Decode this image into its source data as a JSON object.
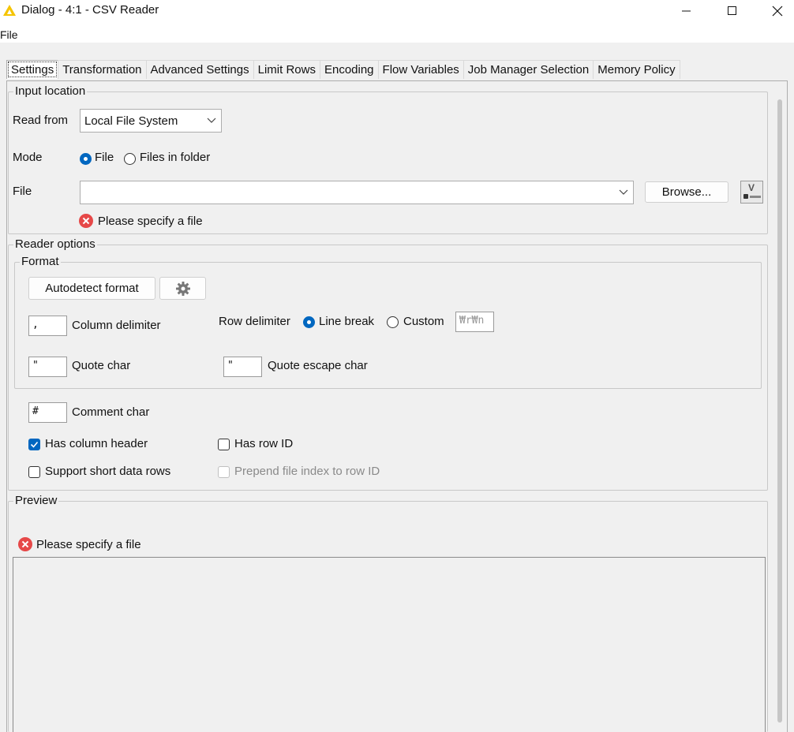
{
  "window": {
    "title": "Dialog - 4:1 - CSV Reader",
    "accent_color": "#f5c400"
  },
  "menubar": {
    "file": "File"
  },
  "tabs": [
    {
      "label": "Settings",
      "active": true
    },
    {
      "label": "Transformation"
    },
    {
      "label": "Advanced Settings"
    },
    {
      "label": "Limit Rows"
    },
    {
      "label": "Encoding"
    },
    {
      "label": "Flow Variables"
    },
    {
      "label": "Job Manager Selection"
    },
    {
      "label": "Memory Policy"
    }
  ],
  "input_location": {
    "legend": "Input location",
    "read_from_label": "Read from",
    "read_from_value": "Local File System",
    "mode_label": "Mode",
    "mode_file": "File",
    "mode_files_in_folder": "Files in folder",
    "file_label": "File",
    "file_value": "",
    "browse_button": "Browse...",
    "flow_var_button": "V",
    "error": "Please specify a file"
  },
  "reader_options": {
    "legend": "Reader options",
    "format_legend": "Format",
    "autodetect_button": "Autodetect format",
    "settings_icon": "gear-icon",
    "column_delimiter_value": ",",
    "column_delimiter_label": "Column delimiter",
    "row_delimiter_label": "Row delimiter",
    "line_break_label": "Line break",
    "custom_label": "Custom",
    "custom_value": "₩r₩n",
    "quote_char_value": "\"",
    "quote_char_label": "Quote char",
    "quote_escape_value": "\"",
    "quote_escape_label": "Quote escape char",
    "comment_char_value": "#",
    "comment_char_label": "Comment char",
    "has_column_header": "Has column header",
    "has_row_id": "Has row ID",
    "support_short_rows": "Support short data rows",
    "prepend_file_index": "Prepend file index to row ID"
  },
  "preview": {
    "legend": "Preview",
    "error": "Please specify a file"
  }
}
